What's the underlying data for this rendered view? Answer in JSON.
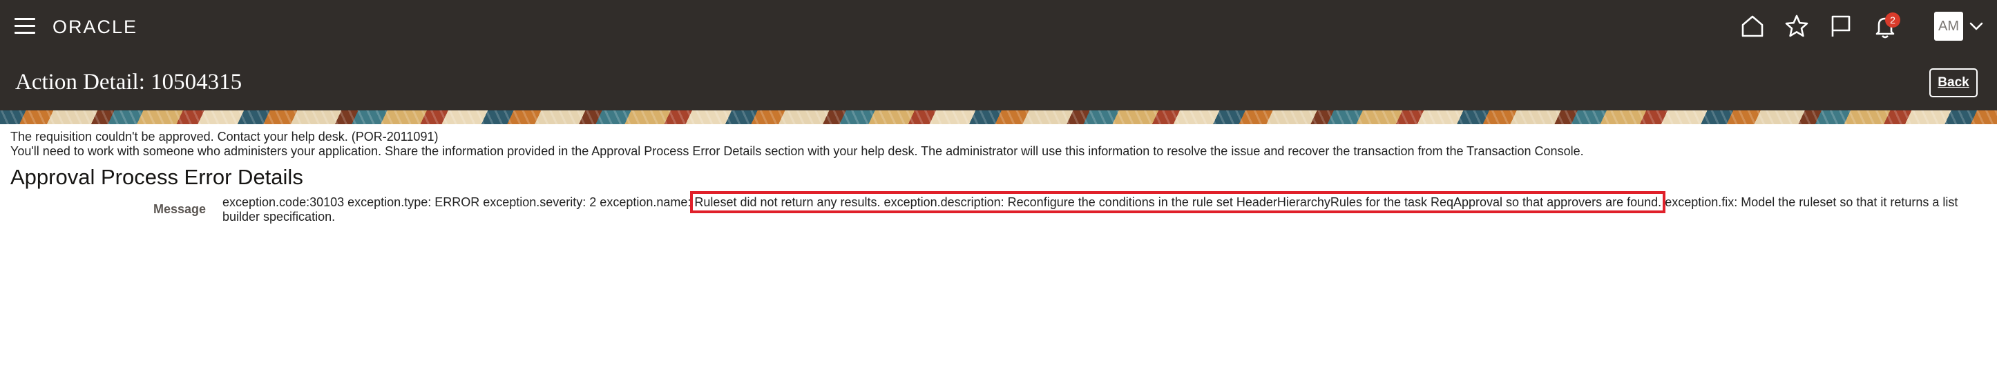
{
  "header": {
    "logo_text": "ORACLE",
    "notification_count": "2",
    "avatar_initials": "AM",
    "icons": [
      "menu-icon",
      "home-icon",
      "star-icon",
      "flag-icon",
      "bell-icon",
      "chevron-down-icon"
    ]
  },
  "page": {
    "title": "Action Detail: 10504315",
    "back_label": "Back"
  },
  "messages": {
    "line1": "The requisition couldn't be approved. Contact your help desk. (POR-2011091)",
    "line2": "You'll need to work with someone who administers your application. Share the information provided in the Approval Process Error Details section with your help desk. The administrator will use this information to resolve the issue and recover the transaction from the Transaction Console."
  },
  "error_details": {
    "heading": "Approval Process Error Details",
    "message_label": "Message",
    "message_prefix": "exception.code:30103 exception.type: ERROR exception.severity: 2 exception.name:",
    "message_highlight": "Ruleset did not return any results. exception.description: Reconfigure the conditions in the rule set HeaderHierarchyRules for the task ReqApproval so that approvers are found.",
    "message_suffix": "exception.fix: Model the ruleset so that it returns a list builder specification."
  },
  "colors": {
    "header_bg": "#312d2a",
    "highlight_border": "#e0202a",
    "badge_bg": "#d93b2b"
  }
}
